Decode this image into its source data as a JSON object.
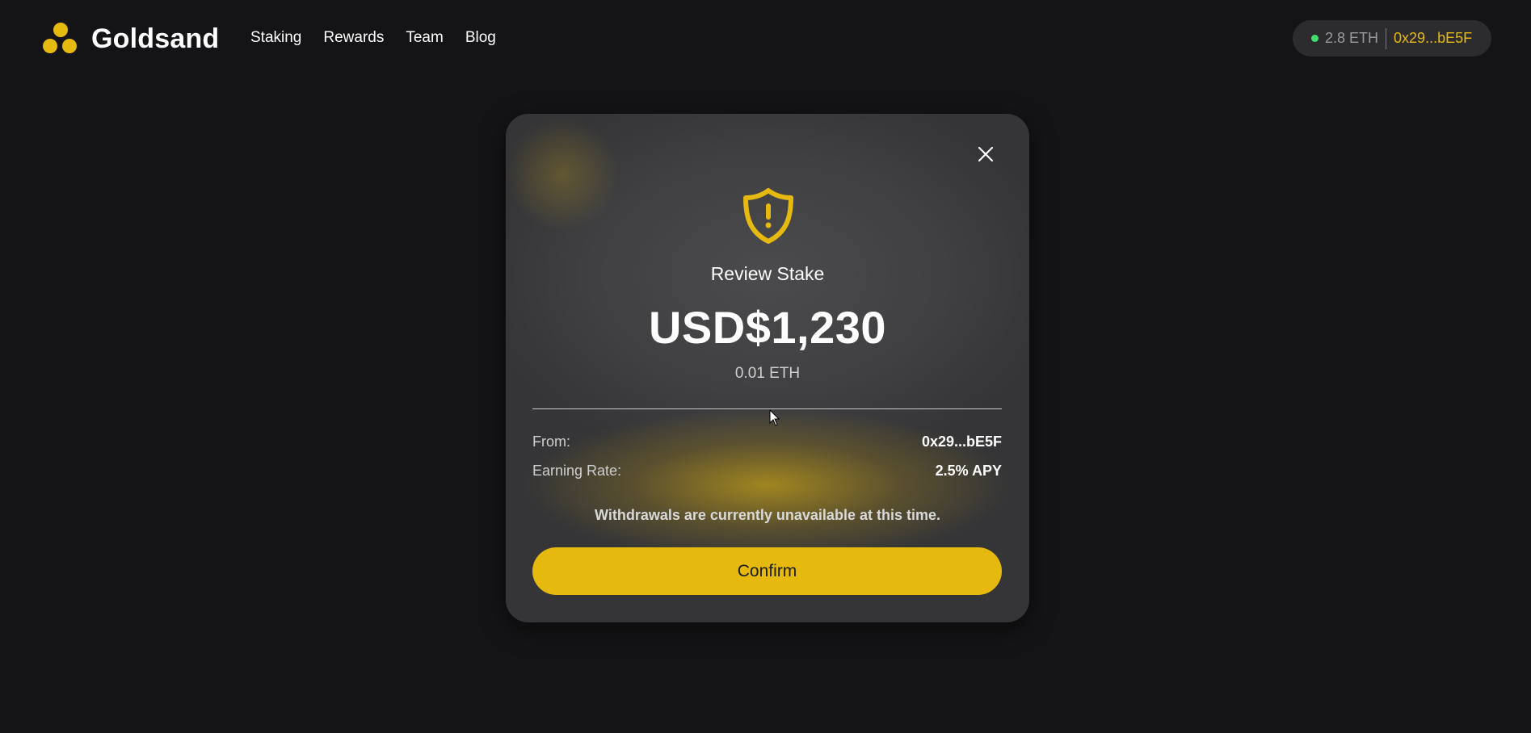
{
  "brand": {
    "name": "Goldsand",
    "accent_color": "#e6b90f"
  },
  "nav": {
    "items": [
      "Staking",
      "Rewards",
      "Team",
      "Blog"
    ]
  },
  "wallet": {
    "balance": "2.8 ETH",
    "address": "0x29...bE5F",
    "status_color": "#3ee06b"
  },
  "modal": {
    "icon": "shield-alert-icon",
    "title": "Review Stake",
    "amount_usd": "USD$1,230",
    "amount_eth": "0.01 ETH",
    "from_label": "From:",
    "from_value": "0x29...bE5F",
    "rate_label": "Earning Rate:",
    "rate_value": "2.5% APY",
    "notice": "Withdrawals are currently unavailable at this time.",
    "confirm_label": "Confirm",
    "close_icon": "close-icon"
  }
}
